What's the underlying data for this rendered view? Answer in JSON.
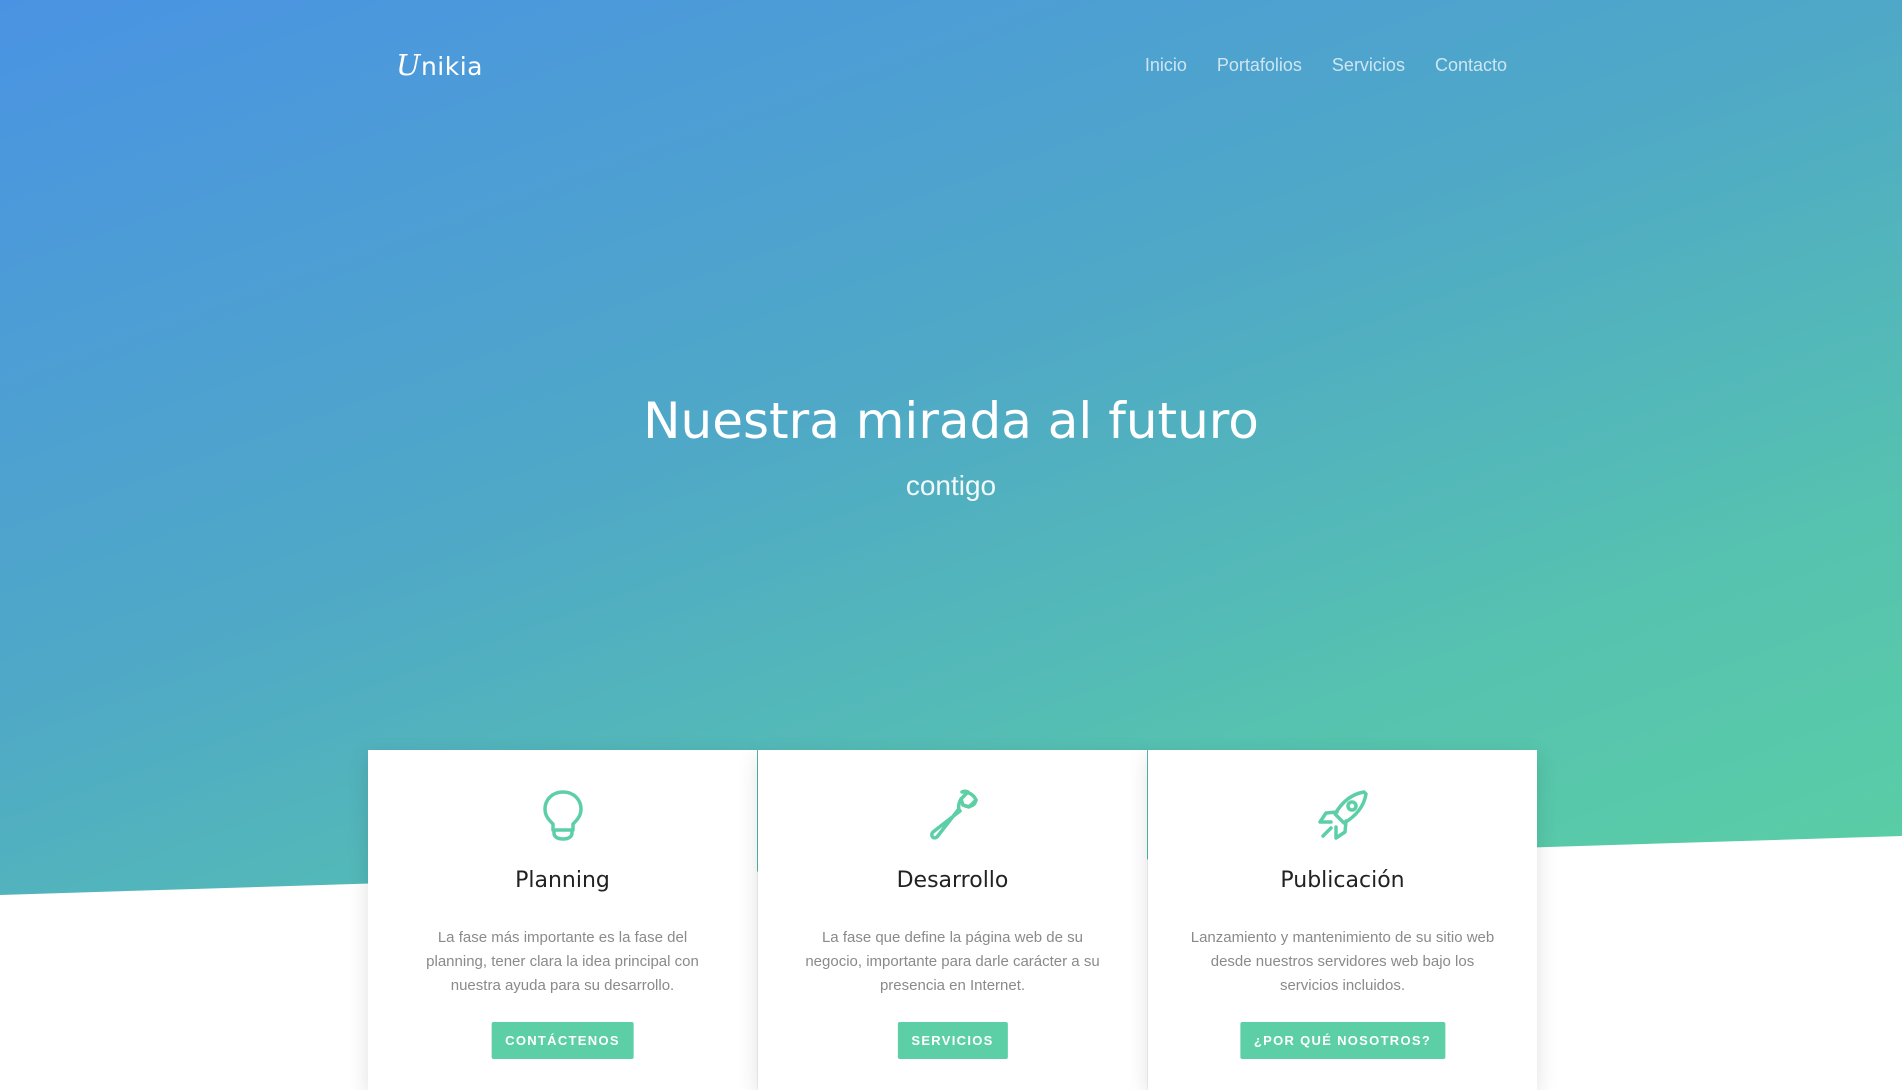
{
  "brand": {
    "initial": "U",
    "rest": "nikia"
  },
  "nav": [
    "Inicio",
    "Portafolios",
    "Servicios",
    "Contacto"
  ],
  "hero": {
    "title": "Nuestra mirada al futuro",
    "subtitle": "contigo"
  },
  "cards": [
    {
      "icon": "lightbulb-icon",
      "title": "Planning",
      "text": "La fase más importante es la fase del planning, tener clara la idea principal con nuestra ayuda para su desarrollo.",
      "button": "CONTÁCTENOS"
    },
    {
      "icon": "wrench-icon",
      "title": "Desarrollo",
      "text": "La fase que define la página web de su negocio, importante para darle carácter a su presencia en Internet.",
      "button": "SERVICIOS"
    },
    {
      "icon": "rocket-icon",
      "title": "Publicación",
      "text": "Lanzamiento y mantenimiento de su sitio web desde nuestros servidores web bajo los servicios incluidos.",
      "button": "¿POR QUÉ NOSOTROS?"
    }
  ],
  "colors": {
    "accent": "#5ccfa7",
    "gradient_start": "#4a93e3",
    "gradient_end": "#5acfa4"
  }
}
